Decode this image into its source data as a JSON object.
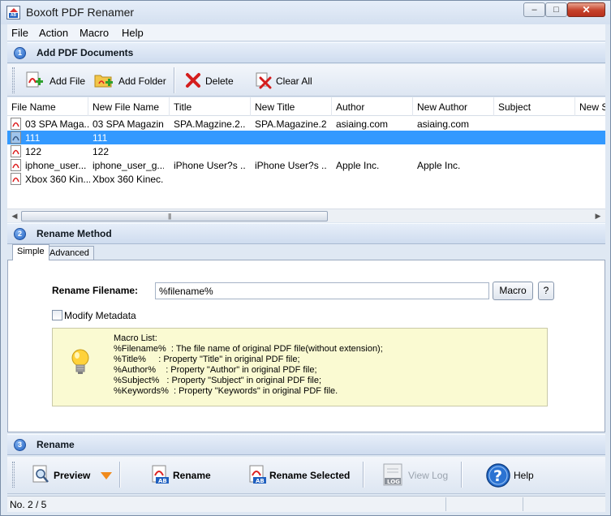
{
  "window": {
    "title": "Boxoft PDF Renamer",
    "min_symbol": "‒",
    "max_symbol": "□",
    "close_symbol": "✕"
  },
  "menu": [
    "File",
    "Action",
    "Macro",
    "Help"
  ],
  "step1": {
    "number": "1",
    "title": "Add PDF Documents"
  },
  "toolbar": {
    "add_file": "Add File",
    "add_folder": "Add Folder",
    "delete": "Delete",
    "clear_all": "Clear All"
  },
  "table": {
    "columns": [
      "File Name",
      "New File Name",
      "Title",
      "New Title",
      "Author",
      "New Author",
      "Subject",
      "New Su"
    ],
    "rows": [
      [
        "03 SPA Maga...",
        "03 SPA Magazin...",
        "SPA.Magzine.2...",
        "SPA.Magazine.2...",
        "asiaing.com",
        "asiaing.com",
        ""
      ],
      [
        "111",
        "111",
        "",
        "",
        "",
        "",
        ""
      ],
      [
        "122",
        "122",
        "",
        "",
        "",
        "",
        ""
      ],
      [
        "iphone_user...",
        "iphone_user_g...",
        "iPhone User?s ...",
        "iPhone User?s ...",
        "Apple Inc.",
        "Apple Inc.",
        ""
      ],
      [
        "Xbox 360 Kin...",
        "Xbox 360 Kinec...",
        "",
        "",
        "",
        "",
        ""
      ]
    ],
    "selected_index": 1
  },
  "step2": {
    "number": "2",
    "title": "Rename Method"
  },
  "tabs": [
    "Simple",
    "Advanced"
  ],
  "rename": {
    "label": "Rename Filename:",
    "value": "%filename%",
    "macro_button": "Macro",
    "help_button": "?",
    "modify_metadata": "Modify Metadata",
    "modify_metadata_checked": false
  },
  "macro_list": [
    "Macro List:",
    "%Filename%  : The file name of original PDF file(without extension);",
    "%Title%     : Property \"Title\" in original PDF file;",
    "%Author%    : Property \"Author\" in original PDF file;",
    "%Subject%   : Property \"Subject\" in original PDF file;",
    "%Keywords%  : Property \"Keywords\" in original PDF file."
  ],
  "step3": {
    "number": "3",
    "title": "Rename"
  },
  "bottom_toolbar": {
    "preview": "Preview",
    "rename": "Rename",
    "rename_selected": "Rename Selected",
    "view_log": "View Log",
    "help": "Help"
  },
  "status": {
    "text": "No. 2 / 5"
  },
  "colors": {
    "selection": "#3399ff",
    "accent": "#2363c2",
    "tip_bg": "#fafad2"
  }
}
